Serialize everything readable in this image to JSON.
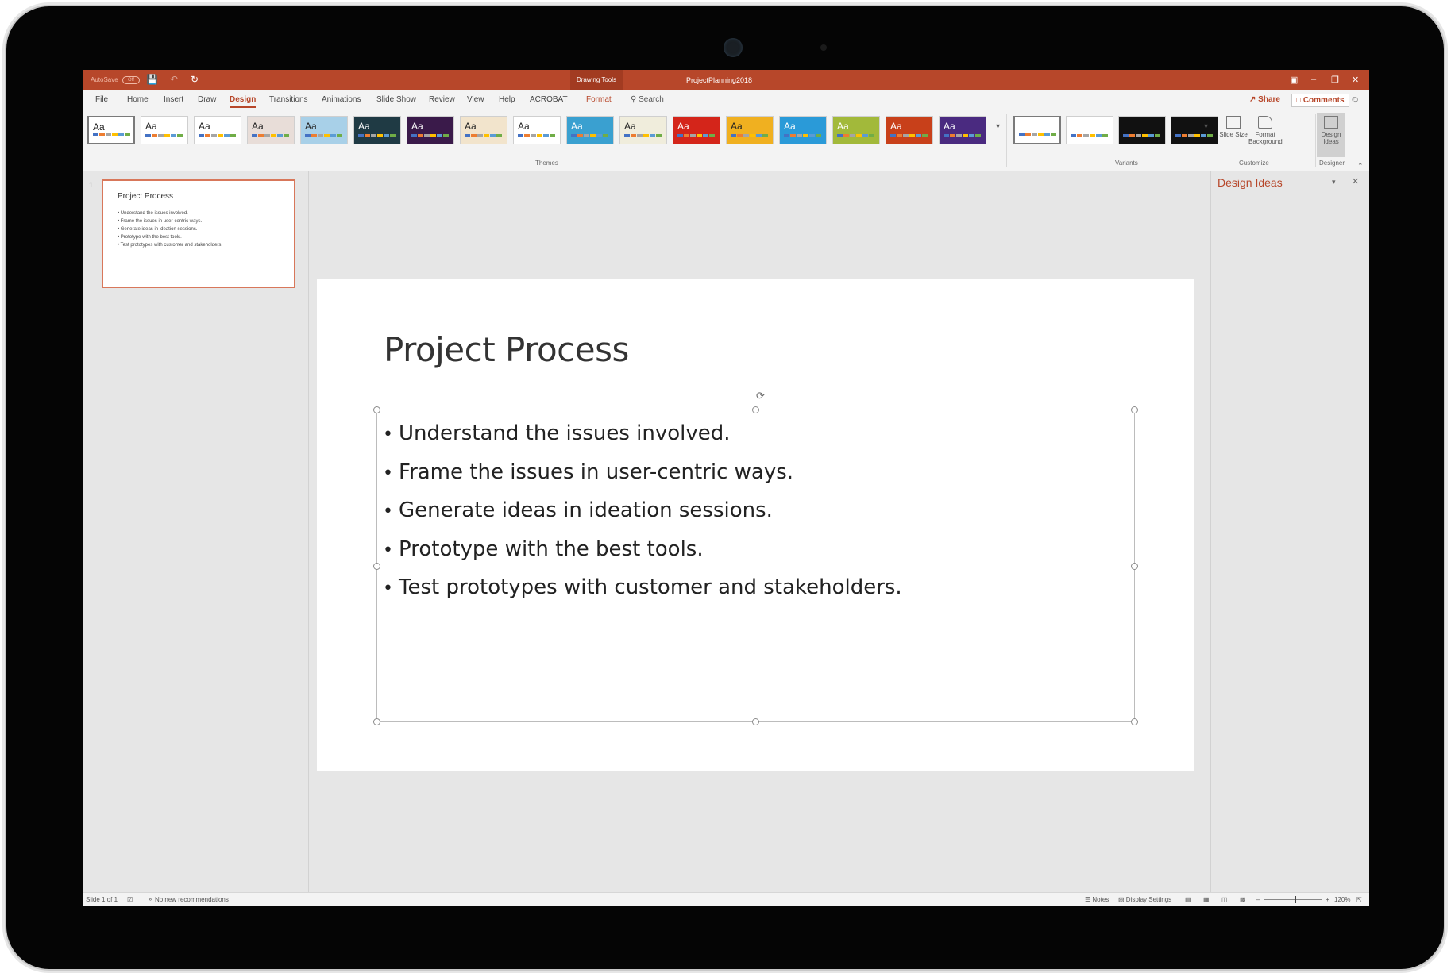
{
  "titlebar": {
    "autosave_label": "AutoSave",
    "autosave_state": "Off",
    "context_tab": "Drawing Tools",
    "document_title": "ProjectPlanning2018"
  },
  "tabs": {
    "file": "File",
    "home": "Home",
    "insert": "Insert",
    "draw": "Draw",
    "design": "Design",
    "transitions": "Transitions",
    "animations": "Animations",
    "slideshow": "Slide Show",
    "review": "Review",
    "view": "View",
    "help": "Help",
    "acrobat": "ACROBAT",
    "format": "Format",
    "search": "Search",
    "share": "Share",
    "comments": "Comments"
  },
  "ribbon": {
    "theme_sample": "Aa",
    "themes_label": "Themes",
    "variants_label": "Variants",
    "customize_label": "Customize",
    "designer_label": "Designer",
    "slide_size_label": "Slide Size",
    "format_background_label": "Format Background",
    "design_ideas_label": "Design Ideas",
    "theme_colors": [
      "#ffffff",
      "#ffffff",
      "#ffffff",
      "#e8ddd8",
      "#a8d0e8",
      "#1f3a44",
      "#3a1a4a",
      "#f2e4cc",
      "#ffffff",
      "#3aa0d0",
      "#f0eddc",
      "#d4251a",
      "#f0b020",
      "#2a9ad8",
      "#a2b93a",
      "#c8401a",
      "#4a2a80"
    ],
    "variant_colors": [
      "#ffffff",
      "#ffffff",
      "#111111",
      "#111111"
    ]
  },
  "thumbnail": {
    "number": "1",
    "title": "Project Process",
    "bullets": [
      "• Understand the issues involved.",
      "• Frame the issues in user-centric ways.",
      "• Generate ideas in ideation sessions.",
      "• Prototype with the best tools.",
      "• Test prototypes with customer and stakeholders."
    ]
  },
  "slide": {
    "title": "Project Process",
    "bullets": [
      "Understand the issues involved.",
      "Frame the issues in user-centric ways.",
      "Generate ideas in ideation sessions.",
      "Prototype with the best tools.",
      "Test prototypes with customer and stakeholders."
    ]
  },
  "design_pane": {
    "title": "Design Ideas"
  },
  "statusbar": {
    "slide_info": "Slide 1 of 1",
    "recommendations": "No new recommendations",
    "notes": "Notes",
    "display_settings": "Display Settings",
    "zoom": "120%"
  },
  "colors": {
    "accent": "#b7472a",
    "titlebar": "#b7472a",
    "ribbon": "#f3f3f3",
    "canvas": "#e6e6e6"
  }
}
